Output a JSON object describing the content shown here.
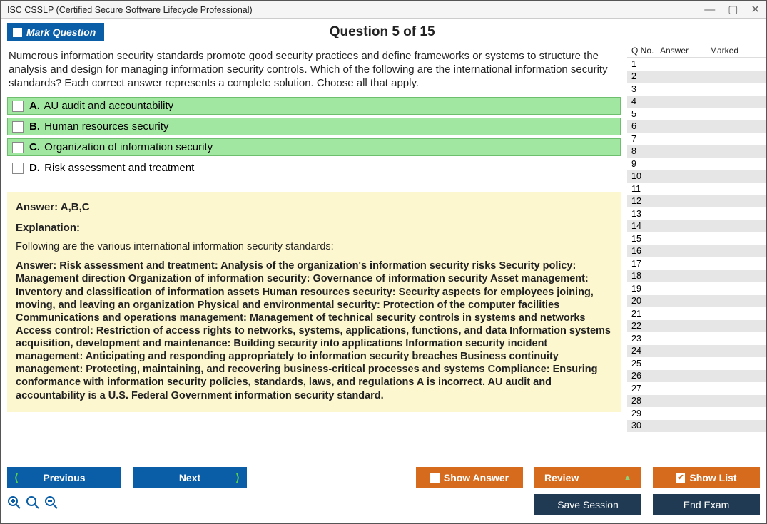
{
  "window": {
    "title": "ISC CSSLP (Certified Secure Software Lifecycle Professional)"
  },
  "header": {
    "mark_label": "Mark Question",
    "question_label": "Question 5 of 15"
  },
  "question": {
    "text": "Numerous information security standards promote good security practices and define frameworks or systems to structure the analysis and design for managing information security controls. Which of the following are the international information security standards? Each correct answer represents a complete solution. Choose all that apply.",
    "options": [
      {
        "letter": "A.",
        "text": "AU audit and accountability",
        "correct": true
      },
      {
        "letter": "B.",
        "text": "Human resources security",
        "correct": true
      },
      {
        "letter": "C.",
        "text": "Organization of information security",
        "correct": true
      },
      {
        "letter": "D.",
        "text": "Risk assessment and treatment",
        "correct": false
      }
    ]
  },
  "answer_panel": {
    "answer_line": "Answer: A,B,C",
    "explanation_header": "Explanation:",
    "explanation_intro": "Following are the various international information security standards:",
    "explanation_body": "Answer: Risk assessment and treatment: Analysis of the organization's information security risks Security policy: Management direction Organization of information security: Governance of information security Asset management: Inventory and classification of information assets Human resources security: Security aspects for employees joining, moving, and leaving an organization Physical and environmental security: Protection of the computer facilities Communications and operations management: Management of technical security controls in systems and networks Access control: Restriction of access rights to networks, systems, applications, functions, and data Information systems acquisition, development and maintenance: Building security into applications Information security incident management: Anticipating and responding appropriately to information security breaches Business continuity management: Protecting, maintaining, and recovering business-critical processes and systems Compliance: Ensuring conformance with information security policies, standards, laws, and regulations A is incorrect. AU audit and accountability is a U.S. Federal Government information security standard."
  },
  "sidebar": {
    "headers": {
      "qno": "Q No.",
      "answer": "Answer",
      "marked": "Marked"
    },
    "rows": [
      1,
      2,
      3,
      4,
      5,
      6,
      7,
      8,
      9,
      10,
      11,
      12,
      13,
      14,
      15,
      16,
      17,
      18,
      19,
      20,
      21,
      22,
      23,
      24,
      25,
      26,
      27,
      28,
      29,
      30
    ]
  },
  "footer": {
    "previous": "Previous",
    "next": "Next",
    "show_answer": "Show Answer",
    "review": "Review",
    "show_list": "Show List",
    "save_session": "Save Session",
    "end_exam": "End Exam"
  }
}
